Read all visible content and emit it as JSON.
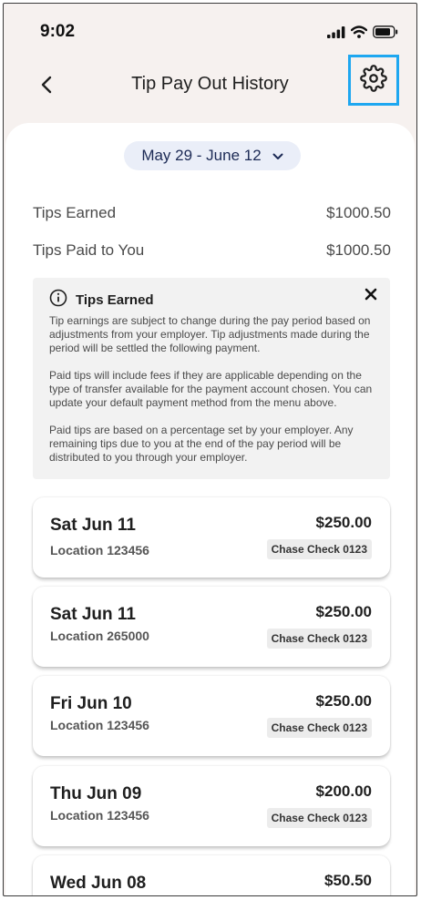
{
  "status_bar": {
    "time": "9:02"
  },
  "header": {
    "title": "Tip Pay Out History"
  },
  "date_range": {
    "label": "May 29 - June 12"
  },
  "summary": {
    "tips_earned_label": "Tips Earned",
    "tips_earned_value": "$1000.50",
    "tips_paid_label": "Tips Paid to You",
    "tips_paid_value": "$1000.50"
  },
  "info": {
    "title": "Tips Earned",
    "paragraphs": [
      "Tip earnings are subject to change during the pay period based on adjustments from your employer. Tip adjustments made during the period will be settled the following payment.",
      "Paid tips will include fees if they are applicable depending on the type of transfer available for the payment account chosen. You can update your default payment method from the menu above.",
      "Paid tips are based on a percentage set by your employer. Any remaining tips due to you at the end of the pay period will be distributed to you through your employer."
    ]
  },
  "payouts": [
    {
      "date": "Sat Jun 11",
      "location": "Location 123456",
      "amount": "$250.00",
      "account": "Chase Check 0123"
    },
    {
      "date": "Sat Jun 11",
      "location": "Location 265000",
      "amount": "$250.00",
      "account": "Chase Check 0123"
    },
    {
      "date": "Fri Jun 10",
      "location": "Location 123456",
      "amount": "$250.00",
      "account": "Chase Check 0123"
    },
    {
      "date": "Thu Jun 09",
      "location": "Location 123456",
      "amount": "$200.00",
      "account": "Chase Check 0123"
    },
    {
      "date": "Wed Jun 08",
      "location": "",
      "amount": "$50.50",
      "account": ""
    }
  ],
  "icons": {
    "back": "chevron-left-icon",
    "settings": "gear-icon",
    "date_dropdown": "chevron-down-icon",
    "info": "info-circle-icon",
    "close": "close-icon",
    "signal": "cellular-signal-icon",
    "wifi": "wifi-icon",
    "battery": "battery-icon"
  },
  "colors": {
    "header_bg": "#f6f1ef",
    "highlight_border": "#1ea7f0",
    "date_pill_bg": "#eaeef8",
    "date_pill_text": "#1c2a55",
    "info_box_bg": "#f2f2f2",
    "account_badge_bg": "#ececec"
  }
}
